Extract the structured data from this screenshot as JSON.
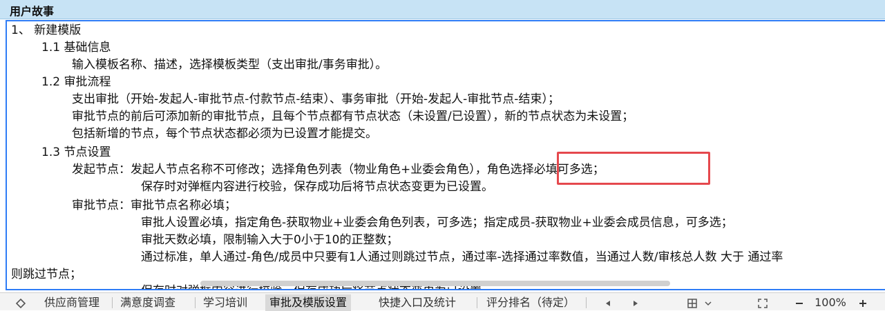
{
  "header": {
    "title": "用户故事"
  },
  "doc": {
    "lines": [
      "1、 新建模版",
      "1.1 基础信息",
      "输入模板名称、描述，选择模板类型（支出审批/事务审批）。",
      "1.2 审批流程",
      "支出审批（开始-发起人-审批节点-付款节点-结束）、事务审批（开始-发起人-审批节点-结束）；",
      "审批节点的前后可添加新的审批节点，且每个节点都有节点状态（未设置/已设置），新的节点状态为未设置；",
      "包括新增的节点，每个节点状态都必须为已设置才能提交。",
      "1.3 节点设置",
      "发起节点：发起人节点名称不可修改；选择角色列表（物业角色+业委会角色），角色选择必填可多选；",
      "保存时对弹框内容进行校验，保存成功后将节点状态变更为已设置。",
      "审批节点：审批节点名称必填；",
      "审批人设置必填，指定角色-获取物业+业委会角色列表，可多选；指定成员-获取物业+业委会成员信息，可多选；",
      "审批天数必填，限制输入大于0小于10的正整数；",
      "通过标准，单人通过-角色/成员中只要有1人通过则跳过节点，通过率-选择通过率数值，当通过人数/审核总人数 大于 通过率",
      "则跳过节点；",
      "保存时对弹框内容进行校验，保存成功后将节点状态变更为已设置。"
    ]
  },
  "tabs": {
    "items": [
      "供应商管理",
      "满意度调查",
      "学习培训",
      "审批及模版设置",
      "快捷入口及统计",
      "评分排名（待定）"
    ],
    "active_index": 3
  },
  "zoom": {
    "level": "100%"
  },
  "icons": {
    "sheet_list": "diamond-outline-icon",
    "prev": "triangle-left-icon",
    "next": "triangle-right-icon",
    "view": "grid-layout-icon",
    "view_dropdown": "chevron-down-icon",
    "fullscreen": "expand-icon",
    "zoom_out": "minus-icon",
    "zoom_in": "plus-icon"
  },
  "colors": {
    "header_bg": "#c7e3f5",
    "content_border": "#2e7cf6",
    "highlight": "#e5484d"
  }
}
